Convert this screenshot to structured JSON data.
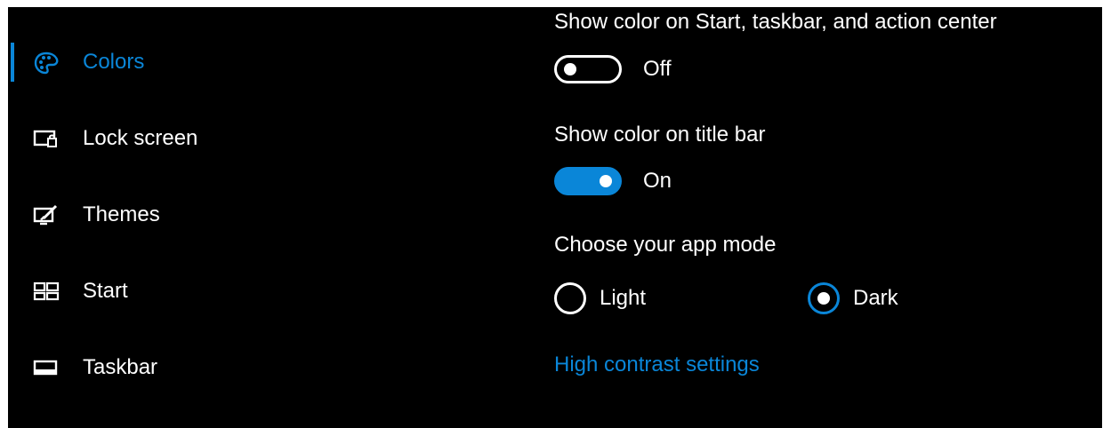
{
  "sidebar": {
    "items": [
      {
        "label": "Colors",
        "icon": "palette-icon",
        "active": true
      },
      {
        "label": "Lock screen",
        "icon": "lock-screen-icon",
        "active": false
      },
      {
        "label": "Themes",
        "icon": "themes-icon",
        "active": false
      },
      {
        "label": "Start",
        "icon": "start-icon",
        "active": false
      },
      {
        "label": "Taskbar",
        "icon": "taskbar-icon",
        "active": false
      }
    ]
  },
  "settings": {
    "start_color": {
      "heading": "Show color on Start, taskbar, and action center",
      "state": "Off",
      "on": false
    },
    "title_bar_color": {
      "heading": "Show color on title bar",
      "state": "On",
      "on": true
    },
    "app_mode": {
      "heading": "Choose your app mode",
      "options": [
        "Light",
        "Dark"
      ],
      "selected": "Dark"
    },
    "high_contrast_link": "High contrast settings"
  },
  "colors": {
    "accent": "#0a86d8",
    "background": "#000000",
    "text": "#ffffff"
  }
}
